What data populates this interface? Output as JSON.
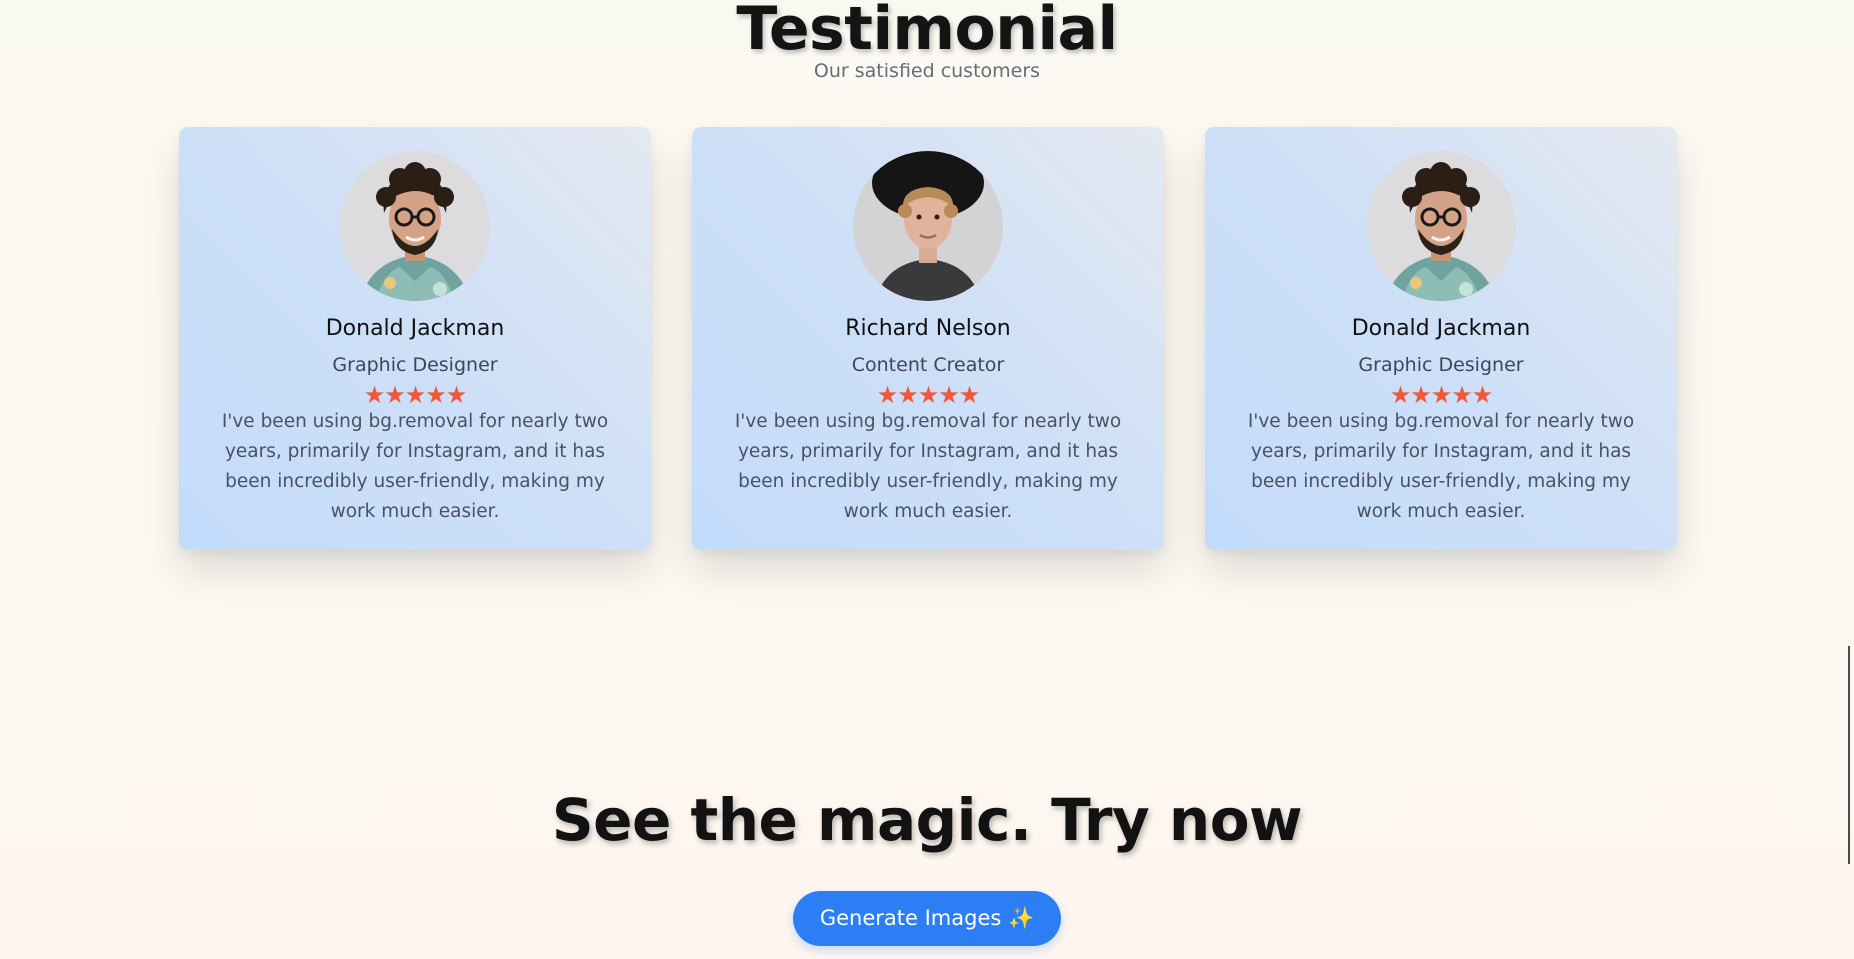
{
  "testimonial": {
    "title": "Testimonial",
    "subtitle": "Our satisfied customers",
    "cards": [
      {
        "name": "Donald Jackman",
        "role": "Graphic Designer",
        "rating": 5,
        "stars": "★★★★★",
        "quote": "I've been using bg.removal for nearly two years, primarily for Instagram, and it has been incredibly user-friendly, making my work much easier."
      },
      {
        "name": "Richard Nelson",
        "role": "Content Creator",
        "rating": 5,
        "stars": "★★★★★",
        "quote": "I've been using bg.removal for nearly two years, primarily for Instagram, and it has been incredibly user-friendly, making my work much easier."
      },
      {
        "name": "Donald Jackman",
        "role": "Graphic Designer",
        "rating": 5,
        "stars": "★★★★★",
        "quote": "I've been using bg.removal for nearly two years, primarily for Instagram, and it has been incredibly user-friendly, making my work much easier."
      }
    ]
  },
  "cta": {
    "title": "See the magic. Try now",
    "button_label": "Generate Images ✨",
    "button_color": "#2b7ef4"
  },
  "colors": {
    "star": "#f0583c",
    "card_gradient_start": "#e4e9f1",
    "card_gradient_end": "#c3dbfb"
  }
}
